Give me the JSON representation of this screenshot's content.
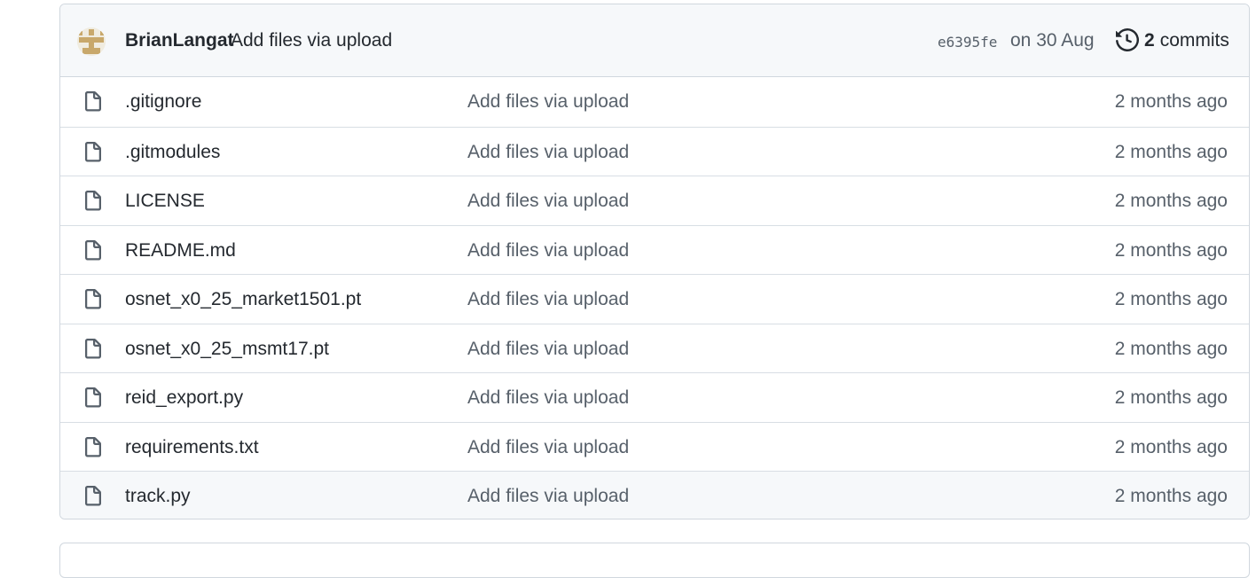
{
  "latest_commit": {
    "author": "BrianLangat",
    "message": "Add files via upload",
    "hash": "e6395fe",
    "date": "on 30 Aug",
    "commits_count": "2",
    "commits_label": "commits",
    "avatar_color": "#c8a86b"
  },
  "files": [
    {
      "name": ".gitignore",
      "commit": "Add files via upload",
      "age": "2 months ago"
    },
    {
      "name": ".gitmodules",
      "commit": "Add files via upload",
      "age": "2 months ago"
    },
    {
      "name": "LICENSE",
      "commit": "Add files via upload",
      "age": "2 months ago"
    },
    {
      "name": "README.md",
      "commit": "Add files via upload",
      "age": "2 months ago"
    },
    {
      "name": "osnet_x0_25_market1501.pt",
      "commit": "Add files via upload",
      "age": "2 months ago"
    },
    {
      "name": "osnet_x0_25_msmt17.pt",
      "commit": "Add files via upload",
      "age": "2 months ago"
    },
    {
      "name": "reid_export.py",
      "commit": "Add files via upload",
      "age": "2 months ago"
    },
    {
      "name": "requirements.txt",
      "commit": "Add files via upload",
      "age": "2 months ago"
    },
    {
      "name": "track.py",
      "commit": "Add files via upload",
      "age": "2 months ago"
    }
  ],
  "icons": {
    "file": "file-icon",
    "history": "history-icon",
    "avatar": "identicon-avatar"
  }
}
